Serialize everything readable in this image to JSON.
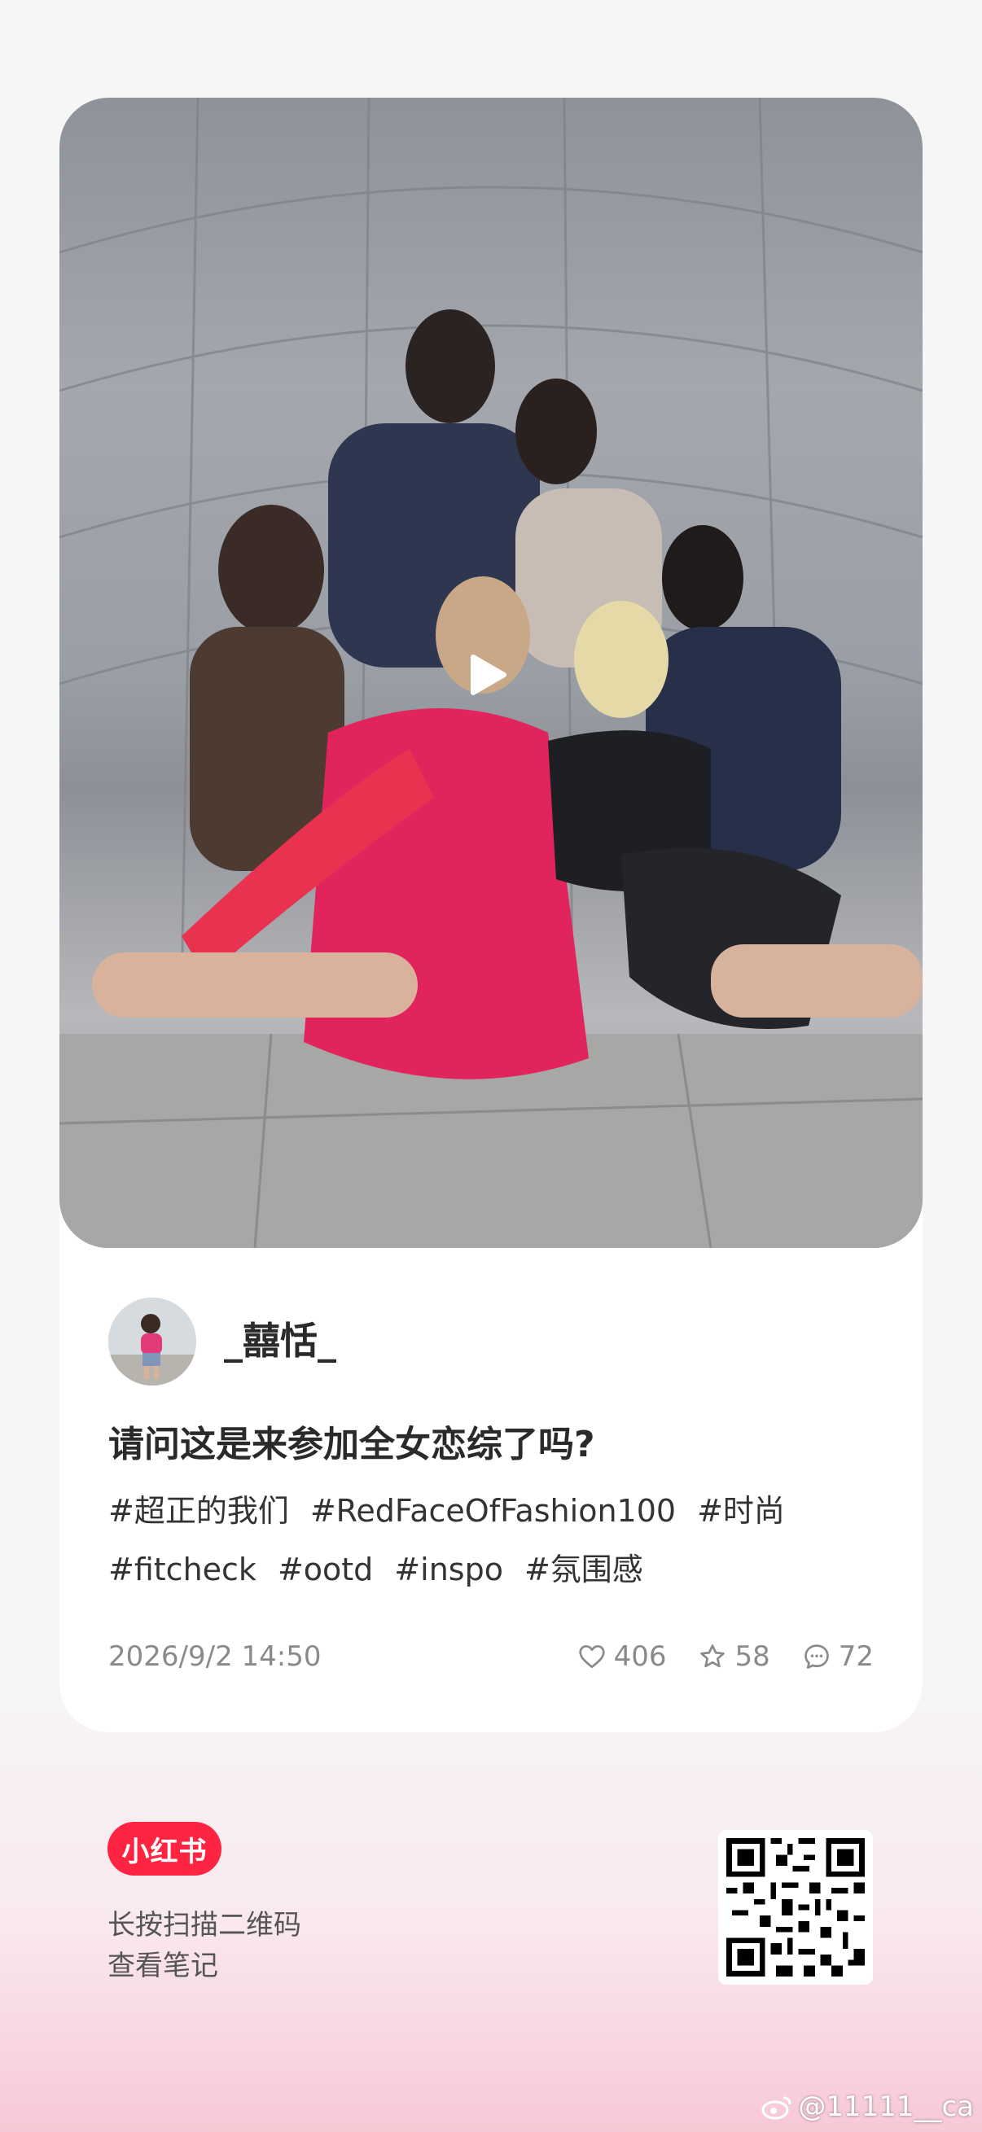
{
  "post": {
    "author": "_囍恬_",
    "title": "请问这是来参加全女恋综了吗?",
    "tags": [
      "#超正的我们",
      "#RedFaceOfFashion100",
      "#时尚",
      "#fitcheck",
      "#ootd",
      "#inspo",
      "#氛围感"
    ],
    "date": "2026/9/2 14:50",
    "likes": "406",
    "collects": "58",
    "comments": "72"
  },
  "footer": {
    "brand": "小红书",
    "hint_line1": "长按扫描二维码",
    "hint_line2": "查看笔记"
  },
  "watermark": "@11111__ca",
  "icons": {
    "play": "play-icon",
    "like": "heart-icon",
    "collect": "star-icon",
    "comment": "comment-icon",
    "weibo": "weibo-icon"
  },
  "colors": {
    "brand": "#ff2442",
    "text_primary": "#2a2a2a",
    "text_secondary": "#8a8a8a"
  }
}
